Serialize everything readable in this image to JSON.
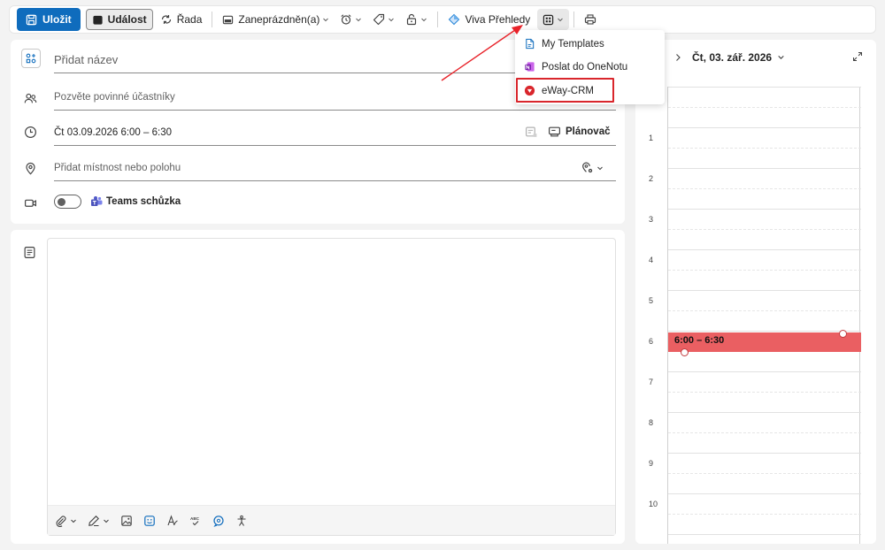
{
  "toolbar": {
    "save_label": "Uložit",
    "event_label": "Událost",
    "series_label": "Řada",
    "busy_label": "Zaneprázdněn(a)",
    "viva_label": "Viva Přehledy"
  },
  "form": {
    "title_placeholder": "Přidat název",
    "attendees_placeholder": "Pozvěte povinné účastníky",
    "datetime_value": "Čt 03.09.2026 6:00 – 6:30",
    "scheduler_label": "Plánovač",
    "location_placeholder": "Přidat místnost nebo polohu",
    "teams_label": "Teams schůzka",
    "teams_enabled": false
  },
  "dropdown": {
    "items": [
      {
        "label": "My Templates",
        "icon": "template-icon"
      },
      {
        "label": "Poslat do OneNotu",
        "icon": "onenote-icon"
      },
      {
        "label": "eWay-CRM",
        "icon": "eway-crm-icon"
      }
    ]
  },
  "calendar": {
    "date_label": "Čt, 03. zář. 2026",
    "hours": [
      "1",
      "2",
      "3",
      "4",
      "5",
      "6",
      "7",
      "8",
      "9",
      "10"
    ],
    "event": {
      "time_label": "6:00 – 6:30",
      "color": "#ea5f62"
    }
  },
  "colors": {
    "accent": "#0f6cbd",
    "highlight": "#d9262c",
    "event": "#ea5f62"
  }
}
